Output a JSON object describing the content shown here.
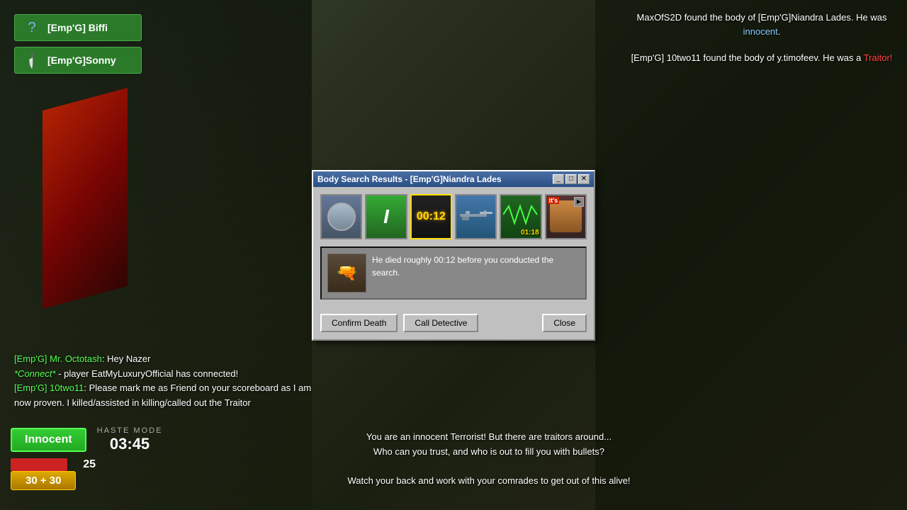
{
  "game": {
    "bg_color": "#2a3a2a"
  },
  "players": {
    "items": [
      {
        "name": "[Emp'G] Biffi",
        "icon": "question"
      },
      {
        "name": "[Emp'G]Sonny",
        "icon": "knife"
      }
    ]
  },
  "notifications": {
    "line1": "MaxOfS2D found the body of [Emp'G]Niandra Lades. He was innocent.",
    "line2": "[Emp'G] 10two11 found the body of y.timofeev. He was a Traitor!"
  },
  "chat": {
    "lines": [
      {
        "speaker": "[Emp'G] Mr. Octotash",
        "text": ": Hey Nazer",
        "speaker_color": "green"
      },
      {
        "speaker": "*Connect*",
        "text": " - player EatMyLuxuryOfficial has connected!",
        "speaker_color": "connect"
      },
      {
        "speaker": "[Emp'G] 10two11",
        "text": ": Please mark me as Friend on your scoreboard as I am now proven. I killed/assisted in killing/called out the Traitor",
        "speaker_color": "green"
      }
    ]
  },
  "status": {
    "role": "Innocent",
    "haste_label": "HASTE MODE",
    "time": "03:45",
    "health": "25",
    "ammo": "30 + 30"
  },
  "bottom_message": {
    "line1": "You are an innocent Terrorist! But there are traitors around...",
    "line2": "Who can you trust, and who is out to fill you with bullets?",
    "line3": "",
    "line4": "Watch your back and work with your comrades to get out of this alive!"
  },
  "modal": {
    "title": "Body Search Results - [Emp'G]Niandra Lades",
    "controls": {
      "minimize": "_",
      "maximize": "□",
      "close": "✕"
    },
    "evidence": [
      {
        "type": "person",
        "label": ""
      },
      {
        "type": "green-i",
        "label": ""
      },
      {
        "type": "timer",
        "label": "00:12",
        "selected": true
      },
      {
        "type": "rifle",
        "label": ""
      },
      {
        "type": "wave",
        "label": "01:18"
      },
      {
        "type": "char",
        "label": "",
        "badge": "it's",
        "has_play": true
      }
    ],
    "info_text": "He died roughly 00:12 before you conducted the search.",
    "buttons": {
      "confirm_death": "Confirm Death",
      "call_detective": "Call Detective",
      "close": "Close"
    }
  }
}
